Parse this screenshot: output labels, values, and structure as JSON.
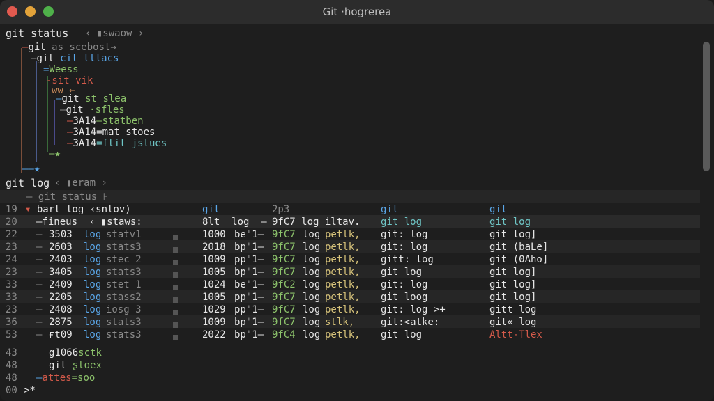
{
  "window": {
    "title": "Git ·hogrerea",
    "colors": {
      "close": "#e25a4f",
      "minimize": "#e3a33a",
      "zoom": "#4fb14a"
    }
  },
  "status": {
    "header": "git status",
    "header_tag": "‹ ▮swaow ›",
    "tree": [
      {
        "pre": "—",
        "text": "git",
        "rest": " as scebost→"
      },
      {
        "pre": "—",
        "text": "git",
        "rest": " cit tllacs"
      },
      {
        "pre": "→",
        "text": "",
        "rest": "Weess"
      },
      {
        "pre": "",
        "text": "",
        "rest": "-sit vik"
      },
      {
        "pre": "",
        "text": "",
        "rest": "ww ←"
      },
      {
        "pre": "—",
        "text": "git",
        "rest": " st_slea"
      },
      {
        "pre": "—",
        "text": "git",
        "rest": " ·sfles"
      },
      {
        "pre": "—",
        "text": "3A14",
        "rest": "—statben"
      },
      {
        "pre": "—",
        "text": "3A14",
        "rest": "=mat stoes"
      },
      {
        "pre": "—",
        "text": "3A14",
        "rest": "=flit jstues"
      }
    ]
  },
  "log": {
    "header": "git log",
    "header_tag": "‹ ▮eram ›",
    "sub": "— git status ⊦",
    "row19": {
      "num": "19",
      "label": "bart log ‹snlov)"
    },
    "col_heads": [
      "git",
      "2p3",
      "git",
      "git"
    ],
    "row20": {
      "num": "20",
      "a": "—fineus  ‹ ▮staws:",
      "b": "8lt  log  —",
      "c": "9fC7 log iltav.",
      "d": "git log",
      "e": "git log"
    },
    "rows": [
      {
        "num": "22",
        "id": "3503",
        "w": "log",
        "s": "statv1",
        "n": "1000",
        "op": "be\"1–",
        "h": "9fC7",
        "l": "log",
        "t": "petlk,",
        "g1": "git: log",
        "g2": "git log]"
      },
      {
        "num": "23",
        "id": "2603",
        "w": "log",
        "s": "stats3",
        "n": "2018",
        "op": "bp\"1–",
        "h": "9fC7",
        "l": "log",
        "t": "petlk,",
        "g1": "git: log",
        "g2": "git (baLe]"
      },
      {
        "num": "24",
        "id": "2403",
        "w": "log",
        "s": "stec 2",
        "n": "1009",
        "op": "pp\"1–",
        "h": "9fC7",
        "l": "log",
        "t": "petlk,",
        "g1": "gitt: log",
        "g2": "git (0Aho]"
      },
      {
        "num": "23",
        "id": "3405",
        "w": "log",
        "s": "stats3",
        "n": "1005",
        "op": "bp\"1–",
        "h": "9fC7",
        "l": "log",
        "t": "petlk,",
        "g1": "git log",
        "g2": "git log]"
      },
      {
        "num": "33",
        "id": "2409",
        "w": "log",
        "s": "stet 1",
        "n": "1024",
        "op": "be\"1–",
        "h": "9fC2",
        "l": "log",
        "t": "petlk,",
        "g1": "git: log",
        "g2": "git log]"
      },
      {
        "num": "33",
        "id": "2205",
        "w": "log",
        "s": "stass2",
        "n": "1005",
        "op": "pp\"1–",
        "h": "9fC7",
        "l": "log",
        "t": "petlk,",
        "g1": "git loog",
        "g2": "git log]"
      },
      {
        "num": "23",
        "id": "2408",
        "w": "log",
        "s": "iosg 3",
        "n": "1029",
        "op": "pp\"1–",
        "h": "9fC7",
        "l": "log",
        "t": "petlk,",
        "g1": "git: log >+",
        "g2": "gitt log"
      },
      {
        "num": "36",
        "id": "2875",
        "w": "log",
        "s": "stats3",
        "n": "1009",
        "op": "bp\"1–",
        "h": "9fC7",
        "l": "log",
        "t": "stlk,",
        "g1": "git:<atke:",
        "g2": "git« log"
      },
      {
        "num": "53",
        "id": "ғt09",
        "w": "log",
        "s": "stats3",
        "n": "2022",
        "op": "bp\"1–",
        "h": "9fC4",
        "l": "log",
        "t": "petlk,",
        "g1": "git log",
        "g2": "Altt-Tlex"
      }
    ],
    "tail": [
      {
        "num": "43",
        "a": "g1066",
        "b": "sctk"
      },
      {
        "num": "48",
        "a": "git",
        "b": "ʂloex"
      },
      {
        "num": "48",
        "a": "attes",
        "b": "=soo"
      }
    ],
    "prompt": {
      "num": "00",
      "sym": ">*"
    }
  }
}
